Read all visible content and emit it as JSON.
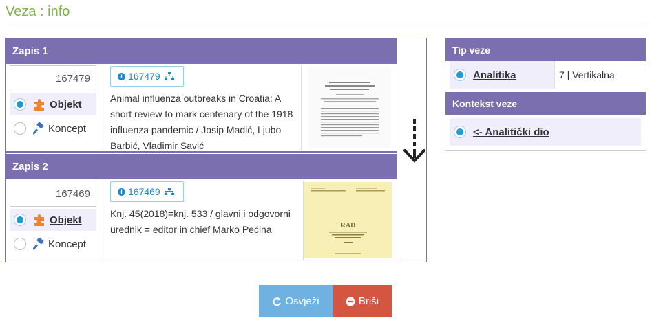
{
  "page": {
    "title": "Veza : info"
  },
  "records": [
    {
      "header": "Zapis 1",
      "id_value": "167479",
      "badge_id": "167479",
      "options": [
        {
          "label": "Objekt",
          "selected": true
        },
        {
          "label": "Koncept",
          "selected": false
        }
      ],
      "text": "Animal influenza outbreaks in Croatia: A short review to mark centenary of the 1918 influenza pandemic / Josip Madić, Ljubo Barbić, Vladimir Savić",
      "thumb_alt": "document page"
    },
    {
      "header": "Zapis 2",
      "id_value": "167469",
      "badge_id": "167469",
      "options": [
        {
          "label": "Objekt",
          "selected": true
        },
        {
          "label": "Koncept",
          "selected": false
        }
      ],
      "text": "Knj. 45(2018)=knj. 533 / glavni i odgovorni urednik = editor in chief Marko Pećina",
      "thumb_alt": "journal cover",
      "thumb_cover_title": "RAD"
    }
  ],
  "link_type": {
    "header": "Tip veze",
    "option_label": "Analitika",
    "selected": true,
    "extra": "7 | Vertikalna"
  },
  "context": {
    "header": "Kontekst veze",
    "option_label": "<- Analitički dio",
    "selected": true
  },
  "buttons": {
    "refresh_label": "Osvježi",
    "delete_label": "Briši"
  },
  "colors": {
    "title": "#7cb342",
    "header_bg": "#7c6fb0",
    "refresh": "#6fb2e2",
    "delete": "#d45641",
    "radio": "#1e9ad6",
    "selected_row": "#f1eefb"
  }
}
